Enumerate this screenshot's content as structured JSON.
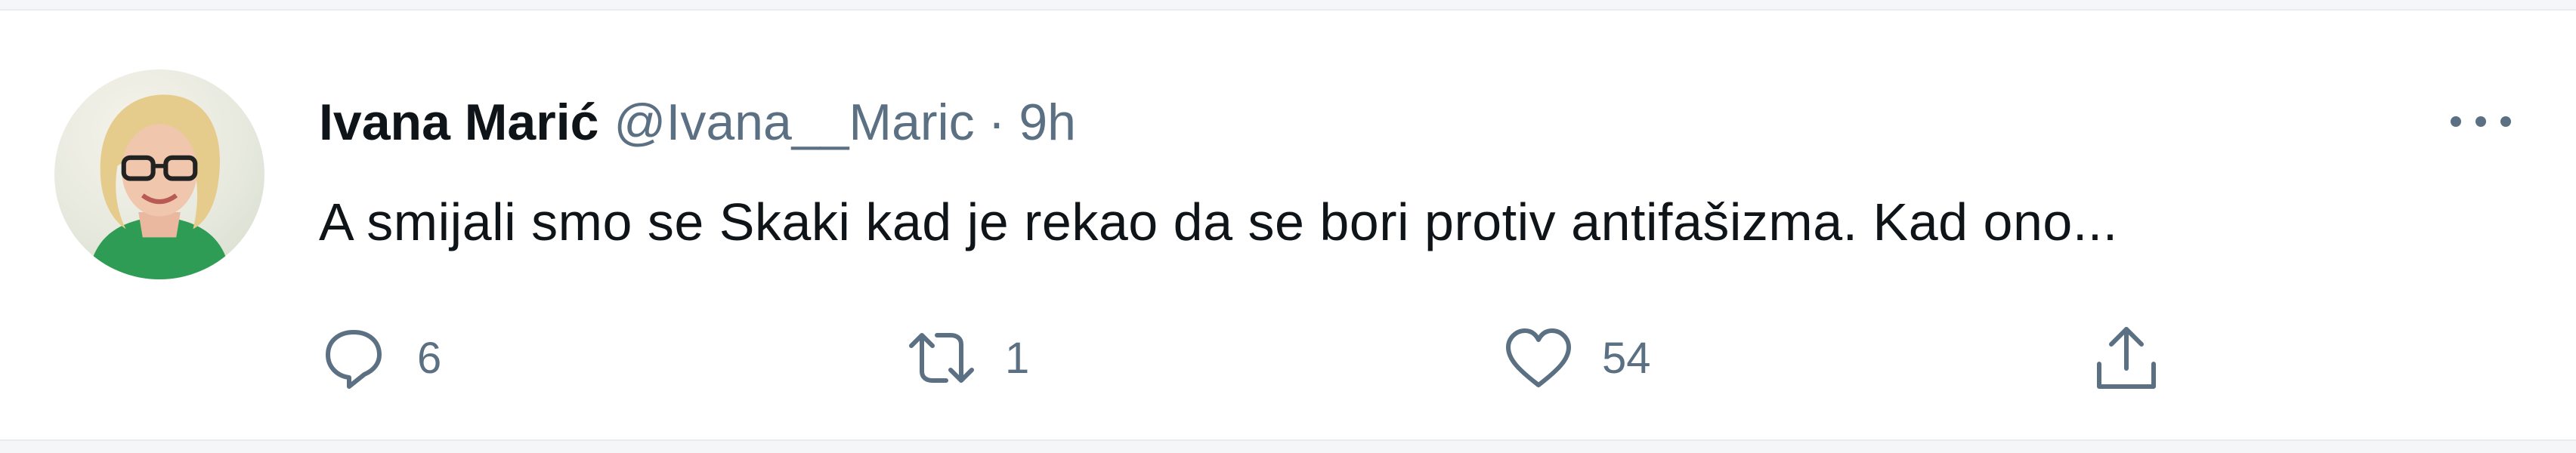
{
  "tweet": {
    "author_name": "Ivana Marić",
    "author_handle": "@Ivana__Maric",
    "separator": "·",
    "time_ago": "9h",
    "text": "A smijali smo se Skaki kad je rekao da se bori protiv antifašizma. Kad ono...",
    "more_icon": "more-horizontal-icon"
  },
  "actions": {
    "reply": {
      "icon": "reply-icon",
      "count": "6"
    },
    "retweet": {
      "icon": "retweet-icon",
      "count": "1"
    },
    "like": {
      "icon": "heart-icon",
      "count": "54"
    },
    "share": {
      "icon": "share-icon"
    }
  },
  "colors": {
    "text_primary": "#0f1419",
    "text_secondary": "#5b7083",
    "border": "#e6ecf0",
    "background": "#f5f6f7"
  }
}
